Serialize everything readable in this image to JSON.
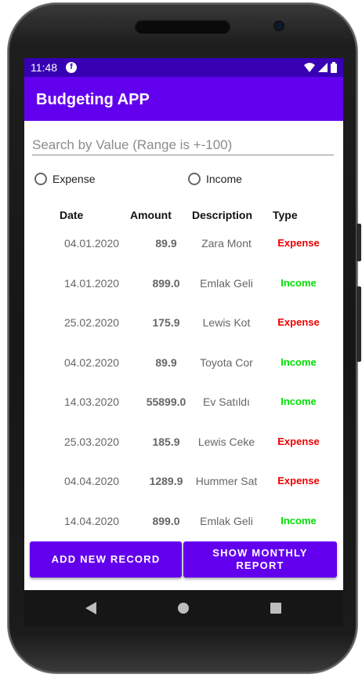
{
  "status_bar": {
    "time": "11:48"
  },
  "app_bar": {
    "title": "Budgeting APP"
  },
  "search": {
    "placeholder": "Search by Value (Range is +-100)",
    "value": ""
  },
  "filters": {
    "expense_label": "Expense",
    "income_label": "Income"
  },
  "table": {
    "headers": {
      "date": "Date",
      "amount": "Amount",
      "description": "Description",
      "type": "Type"
    },
    "rows": [
      {
        "date": "04.01.2020",
        "amount": "89.9",
        "description": "Zara Mont",
        "type": "Expense"
      },
      {
        "date": "14.01.2020",
        "amount": "899.0",
        "description": "Emlak Geli",
        "type": "Income"
      },
      {
        "date": "25.02.2020",
        "amount": "175.9",
        "description": "Lewis Kot",
        "type": "Expense"
      },
      {
        "date": "04.02.2020",
        "amount": "89.9",
        "description": "Toyota Cor",
        "type": "Income"
      },
      {
        "date": "14.03.2020",
        "amount": "55899.0",
        "description": "Ev Satıldı",
        "type": "Income"
      },
      {
        "date": "25.03.2020",
        "amount": "185.9",
        "description": "Lewis Ceke",
        "type": "Expense"
      },
      {
        "date": "04.04.2020",
        "amount": "1289.9",
        "description": "Hummer Sat",
        "type": "Expense"
      },
      {
        "date": "14.04.2020",
        "amount": "899.0",
        "description": "Emlak Geli",
        "type": "Income"
      }
    ]
  },
  "buttons": {
    "add_record": "ADD NEW RECORD",
    "monthly_report": "SHOW MONTHLY REPORT"
  },
  "colors": {
    "primary": "#6200ee",
    "status_bar": "#3700b3",
    "expense": "#ee0000",
    "income": "#00e000"
  }
}
